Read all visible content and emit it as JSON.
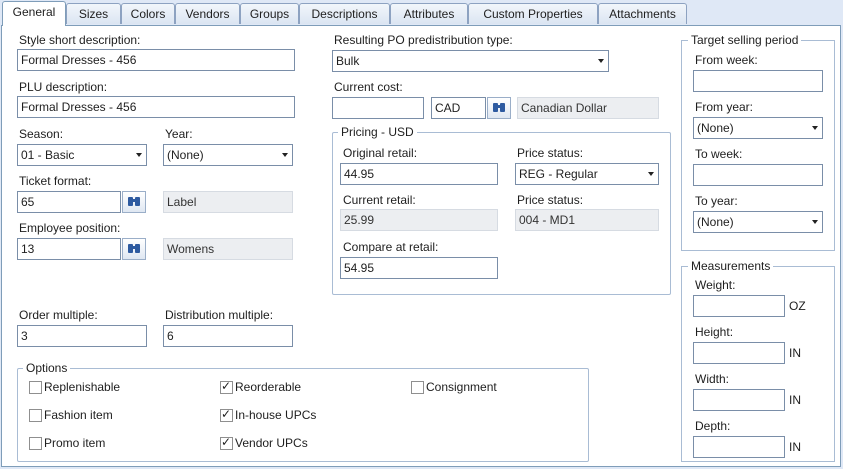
{
  "tabs": [
    {
      "label": "General",
      "active": true
    },
    {
      "label": "Sizes"
    },
    {
      "label": "Colors"
    },
    {
      "label": "Vendors"
    },
    {
      "label": "Groups"
    },
    {
      "label": "Descriptions"
    },
    {
      "label": "Attributes"
    },
    {
      "label": "Custom Properties"
    },
    {
      "label": "Attachments"
    }
  ],
  "left": {
    "style_short_label": "Style short description:",
    "style_short_value": "Formal Dresses - 456",
    "plu_label": "PLU description:",
    "plu_value": "Formal Dresses - 456",
    "season_label": "Season:",
    "season_value": "01 - Basic",
    "year_label": "Year:",
    "year_value": "(None)",
    "ticket_label": "Ticket format:",
    "ticket_value": "65",
    "ticket_desc": "Label",
    "employee_label": "Employee position:",
    "employee_value": "13",
    "employee_desc": "Womens",
    "order_mult_label": "Order multiple:",
    "order_mult_value": "3",
    "dist_mult_label": "Distribution multiple:",
    "dist_mult_value": "6"
  },
  "middle": {
    "po_label": "Resulting PO predistribution type:",
    "po_value": "Bulk",
    "cost_label": "Current cost:",
    "cost_value": "",
    "currency_code": "CAD",
    "currency_name": "Canadian Dollar",
    "pricing_title": "Pricing - USD",
    "orig_retail_label": "Original retail:",
    "orig_retail_value": "44.95",
    "price_status_label": "Price status:",
    "price_status_value": "REG - Regular",
    "curr_retail_label": "Current retail:",
    "curr_retail_value": "25.99",
    "price_status2_label": "Price status:",
    "price_status2_value": "004 - MD1",
    "compare_label": "Compare at retail:",
    "compare_value": "54.95"
  },
  "options": {
    "title": "Options",
    "items": [
      {
        "label": "Replenishable",
        "checked": false
      },
      {
        "label": "Fashion item",
        "checked": false
      },
      {
        "label": "Promo item",
        "checked": false
      },
      {
        "label": "Reorderable",
        "checked": true
      },
      {
        "label": "In-house UPCs",
        "checked": true
      },
      {
        "label": "Vendor UPCs",
        "checked": true
      },
      {
        "label": "Consignment",
        "checked": false
      }
    ]
  },
  "target": {
    "title": "Target selling period",
    "from_week_label": "From week:",
    "from_week_value": "",
    "from_year_label": "From year:",
    "from_year_value": "(None)",
    "to_week_label": "To week:",
    "to_week_value": "",
    "to_year_label": "To year:",
    "to_year_value": "(None)"
  },
  "measurements": {
    "title": "Measurements",
    "weight_label": "Weight:",
    "weight_unit": "OZ",
    "height_label": "Height:",
    "height_unit": "IN",
    "width_label": "Width:",
    "width_unit": "IN",
    "depth_label": "Depth:",
    "depth_unit": "IN"
  },
  "icons": {
    "lookup": "binoculars-icon",
    "dropdown": "chevron-down-icon",
    "check": "✓"
  }
}
